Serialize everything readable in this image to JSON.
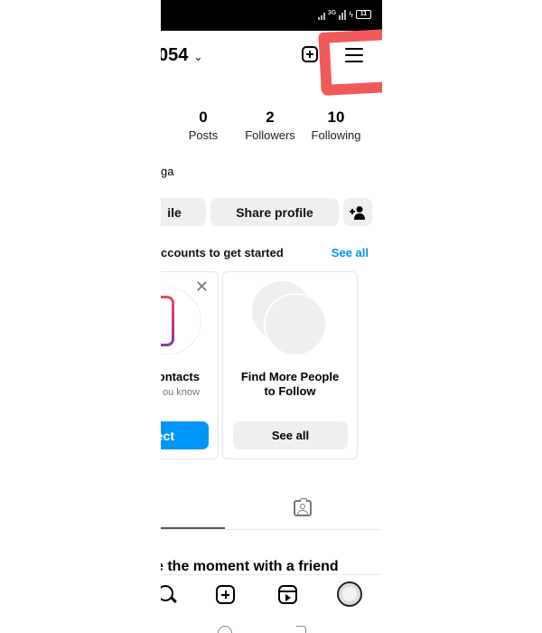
{
  "status_bar": {
    "network": "3G",
    "battery": "11"
  },
  "header": {
    "username": "054",
    "chevron_icon": "chevron-down-icon",
    "new_post_icon": "plus-square-icon",
    "menu_icon": "hamburger-menu-icon"
  },
  "stats": [
    {
      "value": "0",
      "label": "Posts"
    },
    {
      "value": "2",
      "label": "Followers"
    },
    {
      "value": "10",
      "label": "Following"
    }
  ],
  "bio": {
    "name": "ga"
  },
  "actions": {
    "edit_label": "ile",
    "share_label": "Share profile",
    "add_user_icon": "person-add-icon"
  },
  "discover": {
    "title": "ccounts to get started",
    "see_all": "See all",
    "cards": [
      {
        "title": "ontacts",
        "subtitle": "ou know",
        "button": "ect"
      },
      {
        "title_line1": "Find More People",
        "title_line2": "to Follow",
        "button": "See all"
      }
    ]
  },
  "tabs": {
    "tagged_icon": "tagged-person-icon"
  },
  "content": {
    "moment_text": "e the moment with a friend"
  },
  "bottom_nav": {
    "items": [
      "search-icon",
      "plus-square-icon",
      "reels-icon",
      "profile-avatar"
    ]
  },
  "colors": {
    "accent": "#0095f6",
    "annotation": "#f25a5a",
    "button_bg": "#efefef"
  }
}
